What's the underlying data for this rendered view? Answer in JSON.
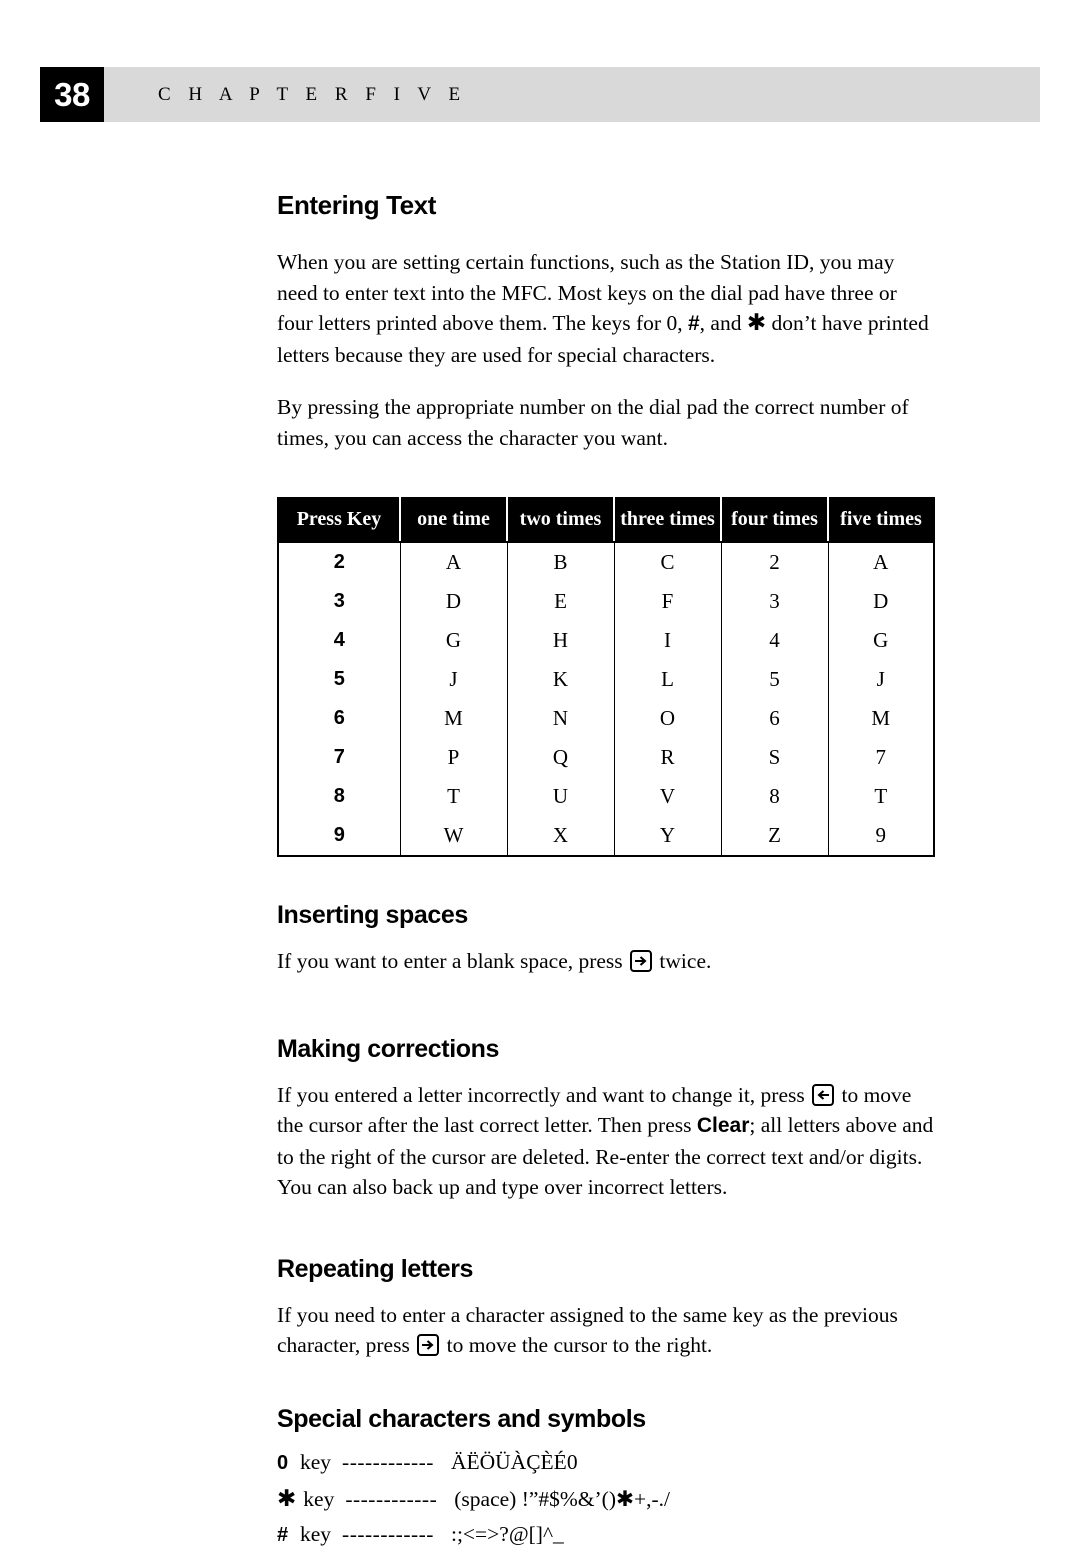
{
  "header": {
    "page_number": "38",
    "chapter_label": "C H A P T E R   F I V E"
  },
  "sections": {
    "entering_text": {
      "heading": "Entering Text",
      "paragraph_1_part1": "When you are setting certain functions, such as the Station ID, you may need to enter text into the MFC. Most keys on the dial pad have three or four letters printed above them. The keys for 0, ",
      "paragraph_1_hash": "#",
      "paragraph_1_part2": ", and ",
      "paragraph_1_star": "✱",
      "paragraph_1_part3": " don’t have printed letters because they are used for special characters.",
      "paragraph_2": "By pressing the appropriate number on the dial pad the correct number of times, you can access the character you want."
    },
    "inserting_spaces": {
      "heading": "Inserting spaces",
      "text_before": "If you want to enter a blank space, press",
      "icon": "right-arrow-key-icon",
      "text_after": "twice."
    },
    "making_corrections": {
      "heading": "Making corrections",
      "text_before": "If you entered a letter incorrectly and want to change it, press",
      "icon": "left-arrow-key-icon",
      "text_middle": "to move the cursor after the last correct letter. Then press ",
      "clear_label": "Clear",
      "text_after": "; all letters above and to the right of the cursor are deleted. Re-enter the correct text and/or digits. You can also back up and type over incorrect letters."
    },
    "repeating_letters": {
      "heading": "Repeating letters",
      "text_before": "If you need to enter a character assigned to the same key as the previous character, press",
      "icon": "right-arrow-key-icon",
      "text_after": "to move the cursor to the right."
    },
    "special_characters": {
      "heading": "Special characters and symbols",
      "word_key": "key",
      "dashes": "------------",
      "rows": [
        {
          "key": "0",
          "value": "ÄËÖÜÀÇÈÉ0"
        },
        {
          "key": "✱",
          "value": "(space) !”#$%&’()✱+,-./"
        },
        {
          "key": "#",
          "value": ":;<=>?@[]^_"
        }
      ]
    }
  },
  "press_key_table": {
    "columns": [
      "Press Key",
      "one time",
      "two times",
      "three times",
      "four times",
      "five times"
    ],
    "rows": [
      [
        "2",
        "A",
        "B",
        "C",
        "2",
        "A"
      ],
      [
        "3",
        "D",
        "E",
        "F",
        "3",
        "D"
      ],
      [
        "4",
        "G",
        "H",
        "I",
        "4",
        "G"
      ],
      [
        "5",
        "J",
        "K",
        "L",
        "5",
        "J"
      ],
      [
        "6",
        "M",
        "N",
        "O",
        "6",
        "M"
      ],
      [
        "7",
        "P",
        "Q",
        "R",
        "S",
        "7"
      ],
      [
        "8",
        "T",
        "U",
        "V",
        "8",
        "T"
      ],
      [
        "9",
        "W",
        "X",
        "Y",
        "Z",
        "9"
      ]
    ]
  },
  "colors": {
    "header_band": "#d9d9d9",
    "page_number_box": "#000000",
    "table_header_bg": "#000000",
    "text": "#000000"
  }
}
